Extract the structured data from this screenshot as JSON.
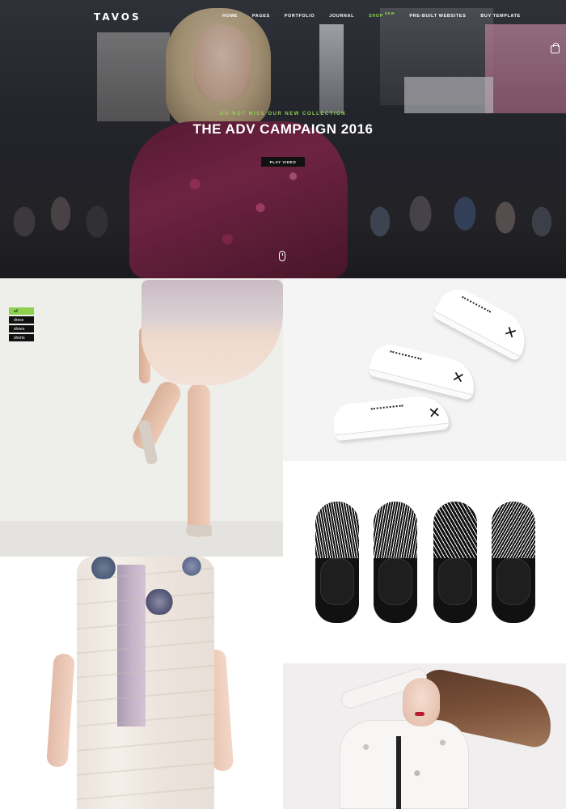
{
  "brand": {
    "logo_text": "TAVOS"
  },
  "nav": {
    "items": [
      {
        "label": "HOME"
      },
      {
        "label": "PAGES"
      },
      {
        "label": "PORTFOLIO"
      },
      {
        "label": "JOURNAL"
      },
      {
        "label": "SHOP",
        "badge": "NEW"
      },
      {
        "label": "PRE-BUILT WEBSITES"
      },
      {
        "label": "BUY TEMPLATE"
      }
    ],
    "active_index": 4,
    "cart_icon": "shopping-bag-icon"
  },
  "hero": {
    "subtitle": "DO NOT MISS OUR NEW COLLECTION",
    "title": "THE ADV CAMPAIGN 2016",
    "button_label": "PLAY VIDEO",
    "scroll_icon": "mouse-scroll-icon"
  },
  "filter": {
    "items": [
      "all",
      "dress",
      "shoes",
      "shorts"
    ],
    "active_index": 0
  },
  "grid": {
    "tiles": [
      {
        "name": "skirt-photo",
        "subject": "pleated skirt and heels"
      },
      {
        "name": "white-sneakers-photo",
        "subject": "white sneakers with black X"
      },
      {
        "name": "black-slipons-photo",
        "subject": "black slip-on shoes"
      },
      {
        "name": "dress-photo",
        "subject": "pastel dress with floral appliques"
      },
      {
        "name": "portrait-photo",
        "subject": "model in printed blouse"
      }
    ]
  },
  "colors": {
    "accent": "#8fd14f",
    "dark": "#111111",
    "light": "#ffffff"
  }
}
